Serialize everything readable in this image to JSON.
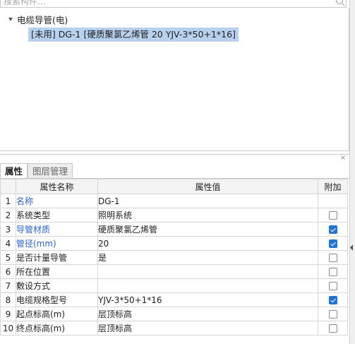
{
  "search": {
    "placeholder": "搜索构件..."
  },
  "tree": {
    "root_label": "电缆导管(电)",
    "child_label": "[未用] DG-1 [硬质聚氯乙烯管 20 YJV-3*50+1*16]"
  },
  "panel": {
    "close_label": "×",
    "tabs": [
      "属性",
      "图层管理"
    ]
  },
  "table": {
    "headers": {
      "num": "",
      "name": "属性名称",
      "value": "属性值",
      "extra": "附加"
    },
    "rows": [
      {
        "num": "1",
        "name": "名称",
        "value": "DG-1",
        "name_color": "blue",
        "checkbox": "none"
      },
      {
        "num": "2",
        "name": "系统类型",
        "value": "照明系统",
        "name_color": "black",
        "checkbox": "unchecked"
      },
      {
        "num": "3",
        "name": "导管材质",
        "value": "硬质聚氯乙烯管",
        "name_color": "blue",
        "checkbox": "checked"
      },
      {
        "num": "4",
        "name": "管径(mm)",
        "value": "20",
        "name_color": "blue",
        "checkbox": "checked"
      },
      {
        "num": "5",
        "name": "是否计量导管",
        "value": "是",
        "name_color": "black",
        "checkbox": "unchecked"
      },
      {
        "num": "6",
        "name": "所在位置",
        "value": "",
        "name_color": "black",
        "checkbox": "unchecked"
      },
      {
        "num": "7",
        "name": "敷设方式",
        "value": "",
        "name_color": "black",
        "checkbox": "unchecked"
      },
      {
        "num": "8",
        "name": "电缆规格型号",
        "value": "YJV-3*50+1*16",
        "name_color": "black",
        "checkbox": "checked"
      },
      {
        "num": "9",
        "name": "起点标高(m)",
        "value": "层顶标高",
        "name_color": "black",
        "checkbox": "unchecked"
      },
      {
        "num": "10",
        "name": "终点标高(m)",
        "value": "层顶标高",
        "name_color": "black",
        "checkbox": "unchecked"
      }
    ]
  },
  "colors": {
    "link_blue": "#2a62c9",
    "selection": "#b8d1ee",
    "check_blue": "#1f73d3"
  }
}
